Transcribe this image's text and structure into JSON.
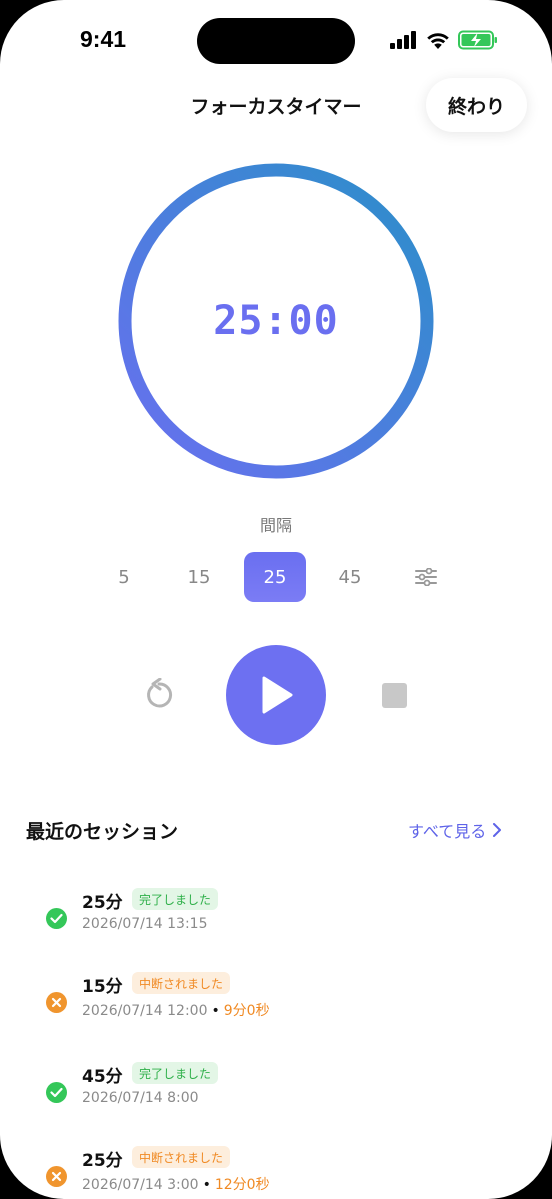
{
  "status_bar": {
    "time": "9:41"
  },
  "header": {
    "title": "フォーカスタイマー",
    "end_button": "終わり"
  },
  "timer": {
    "display": "25:00",
    "progress": 1.0,
    "gradient_colors": [
      "#2b8fc9",
      "#6a6ff0"
    ]
  },
  "interval": {
    "label": "間隔",
    "options": [
      "5",
      "15",
      "25",
      "45"
    ],
    "selected": "25",
    "settings_icon": "sliders-icon"
  },
  "controls": {
    "reset_icon": "reset-icon",
    "play_icon": "play-icon",
    "stop_icon": "stop-icon"
  },
  "recent": {
    "title": "最近のセッション",
    "see_all": "すべて見る",
    "sessions": [
      {
        "duration": "25分",
        "status": "完了しました",
        "status_type": "done",
        "datetime": "2026/07/14 13:15",
        "elapsed": ""
      },
      {
        "duration": "15分",
        "status": "中断されました",
        "status_type": "cut",
        "datetime": "2026/07/14 12:00",
        "elapsed": "9分0秒"
      },
      {
        "duration": "45分",
        "status": "完了しました",
        "status_type": "done",
        "datetime": "2026/07/14 8:00",
        "elapsed": ""
      },
      {
        "duration": "25分",
        "status": "中断されました",
        "status_type": "cut",
        "datetime": "2026/07/14 3:00",
        "elapsed": "12分0秒"
      }
    ]
  },
  "colors": {
    "accent": "#6a6ff0",
    "done": "#34c759",
    "interrupted": "#f0952e"
  }
}
